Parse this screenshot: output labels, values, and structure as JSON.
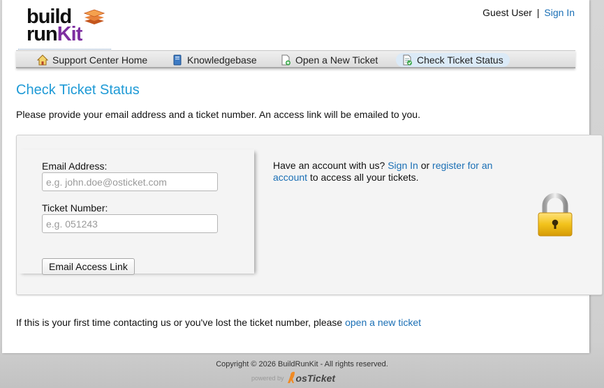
{
  "brand": {
    "logo_line1": "build",
    "logo_line2_a": "run",
    "logo_line2_b": "Kit"
  },
  "user": {
    "guest_label": "Guest User",
    "separator": "|",
    "sign_in": "Sign In"
  },
  "nav": {
    "items": [
      {
        "label": "Support Center Home",
        "icon": "home-icon"
      },
      {
        "label": "Knowledgebase",
        "icon": "book-icon"
      },
      {
        "label": "Open a New Ticket",
        "icon": "new-ticket-icon"
      },
      {
        "label": "Check Ticket Status",
        "icon": "ticket-status-icon",
        "active": true
      }
    ]
  },
  "main": {
    "title": "Check Ticket Status",
    "intro": "Please provide your email address and a ticket number. An access link will be emailed to you."
  },
  "form": {
    "email_label": "Email Address:",
    "email_placeholder": "e.g. john.doe@osticket.com",
    "email_value": "",
    "ticket_label": "Ticket Number:",
    "ticket_placeholder": "e.g. 051243",
    "ticket_value": "",
    "submit_label": "Email Access Link"
  },
  "account": {
    "text_before": "Have an account with us?",
    "sign_in_link": "Sign In",
    "or_text": "or",
    "register_link": "register for an account",
    "text_after": "to access all your tickets."
  },
  "footer_note": {
    "text": "If this is your first time contacting us or you've lost the ticket number, please",
    "link": "open a new ticket"
  },
  "footer": {
    "copyright": "Copyright © 2026 BuildRunKit - All rights reserved.",
    "powered_by": "powered by",
    "brand": "osTicket"
  },
  "colors": {
    "accent": "#1e9ad6",
    "link": "#1a6fb5",
    "logo_purple": "#7d2ea0",
    "lock_gold": "#f2c21b"
  }
}
